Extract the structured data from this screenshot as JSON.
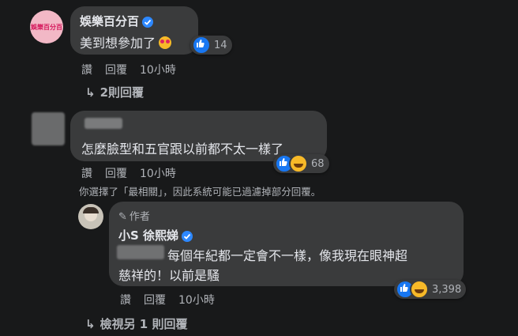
{
  "comment1": {
    "author": "娛樂百分百",
    "avatar_text": "娛樂百分百",
    "text": "美到想參加了",
    "reaction_count": "14",
    "actions": [
      "讚",
      "回覆",
      "10小時"
    ],
    "replies_link": "2則回覆"
  },
  "comment2": {
    "text": "怎麼臉型和五官跟以前都不太一樣了",
    "reaction_count": "68",
    "actions": [
      "讚",
      "回覆",
      "10小時"
    ]
  },
  "filter_note": "你選擇了「最相關」，因此系統可能已過濾掉部分回覆。",
  "reply": {
    "author_badge": "作者",
    "author": "小S 徐熙娣",
    "text_line1": "每個年紀都一定會不一樣，像我現在眼神超",
    "text_line2": "慈祥的！以前是騷",
    "reaction_count": "3,398",
    "actions": [
      "讚",
      "回覆",
      "10小時"
    ]
  },
  "more_replies_link": "檢視另 1 則回覆"
}
